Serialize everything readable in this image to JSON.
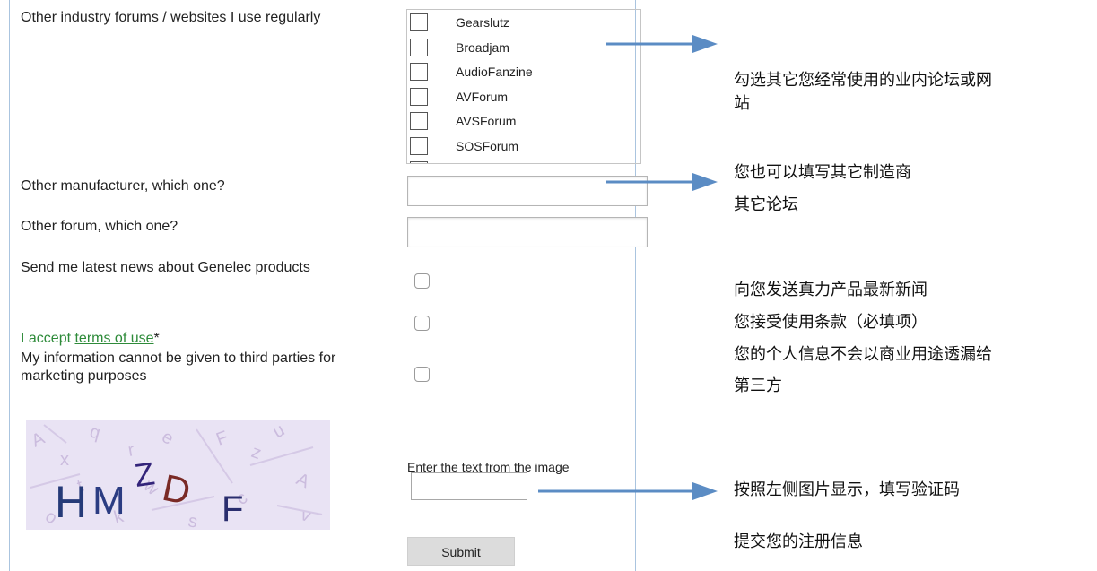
{
  "form": {
    "forums_label": "Other industry forums / websites I use regularly",
    "forums": [
      "Gearslutz",
      "Broadjam",
      "AudioFanzine",
      "AVForum",
      "AVSForum",
      "SOSForum"
    ],
    "other_manufacturer_label": "Other manufacturer, which one?",
    "other_forum_label": "Other forum, which one?",
    "news_label": "Send me latest news about Genelec products",
    "terms_prefix": "I accept ",
    "terms_link": "terms of use",
    "terms_required": "*",
    "privacy_label": "My information cannot be given to third parties for marketing purposes",
    "captcha_text": "HMZDF",
    "captcha_prompt": "Enter the text from the image",
    "submit_label": "Submit"
  },
  "annotations": {
    "forums_note_line1": "勾选其它您经常使用的业内论坛或网",
    "forums_note_line2": "站",
    "other_note_line1": "您也可以填写其它制造商",
    "other_note_line2": "其它论坛",
    "news_note": "向您发送真力产品最新新闻",
    "terms_note": "您接受使用条款（必填项）",
    "privacy_note_line1": "您的个人信息不会以商业用途透漏给",
    "privacy_note_line2": "第三方",
    "captcha_note": "按照左侧图片显示，填写验证码",
    "submit_note": "提交您的注册信息"
  },
  "colors": {
    "arrow": "#5b8cc4",
    "terms_green": "#2e8b3a",
    "frame_border": "#aac4df"
  }
}
